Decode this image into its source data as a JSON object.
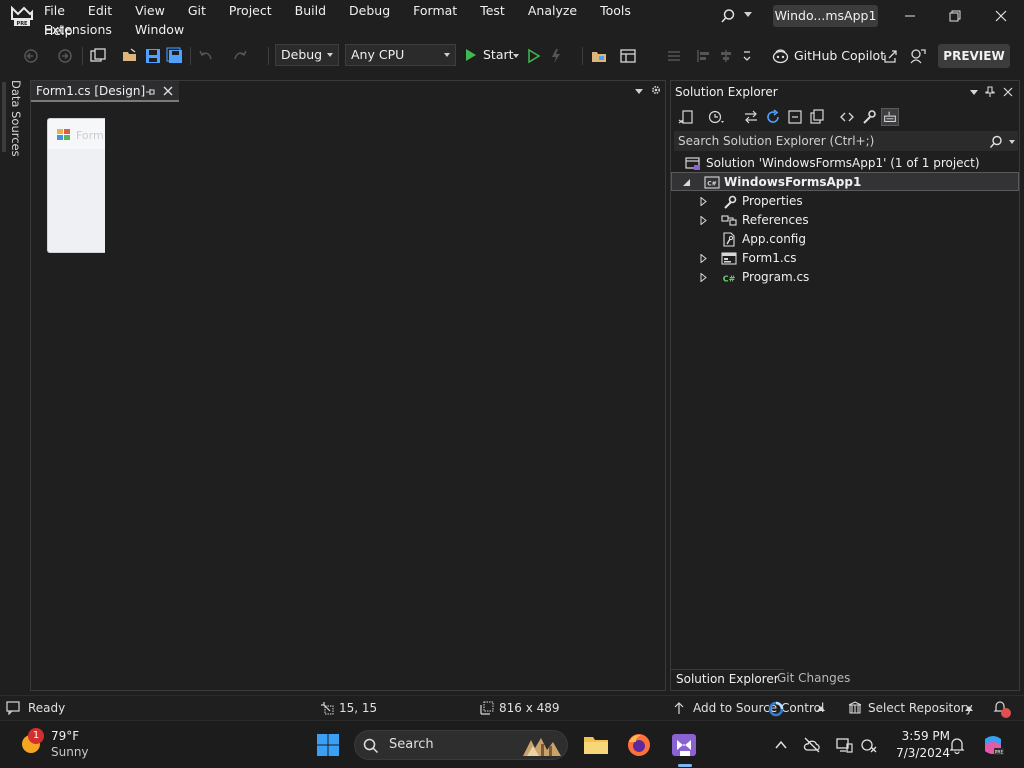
{
  "app": {
    "window_title": "Windo...msApp1",
    "logo_badge": "PRE"
  },
  "menu": {
    "items": [
      "File",
      "Edit",
      "View",
      "Git",
      "Project",
      "Build",
      "Debug",
      "Format",
      "Test",
      "Analyze",
      "Tools",
      "Extensions",
      "Window"
    ],
    "help": "Help"
  },
  "toolbar": {
    "configuration": "Debug",
    "platform": "Any CPU",
    "start_label": "Start",
    "copilot_label": "GitHub Copilot",
    "preview_label": "PREVIEW"
  },
  "side_panel": {
    "tab_label": "Data Sources"
  },
  "document": {
    "tab_label": "Form1.cs [Design]",
    "form_preview_title": "Form"
  },
  "solution_explorer": {
    "title": "Solution Explorer",
    "search_placeholder": "Search Solution Explorer (Ctrl+;)",
    "solution_label": "Solution 'WindowsFormsApp1' (1 of 1 project)",
    "project_label": "WindowsFormsApp1",
    "items": [
      {
        "label": "Properties",
        "icon": "wrench-icon",
        "expandable": true
      },
      {
        "label": "References",
        "icon": "references-icon",
        "expandable": true
      },
      {
        "label": "App.config",
        "icon": "config-file-icon",
        "expandable": false
      },
      {
        "label": "Form1.cs",
        "icon": "form-file-icon",
        "expandable": true
      },
      {
        "label": "Program.cs",
        "icon": "csharp-file-icon",
        "expandable": true
      }
    ],
    "tabs": [
      "Solution Explorer",
      "Git Changes"
    ]
  },
  "statusbar": {
    "ready": "Ready",
    "position": "15, 15",
    "size": "816 x 489",
    "source_control": "Add to Source Control",
    "repository": "Select Repository"
  },
  "taskbar": {
    "temperature": "79°F",
    "condition": "Sunny",
    "weather_badge": "1",
    "search_label": "Search",
    "time": "3:59 PM",
    "date": "7/3/2024"
  },
  "colors": {
    "background": "#1f1f1f",
    "accent_green": "#3fb950",
    "accent_blue": "#4ea1ff",
    "vs_purple": "#8a63d2"
  }
}
